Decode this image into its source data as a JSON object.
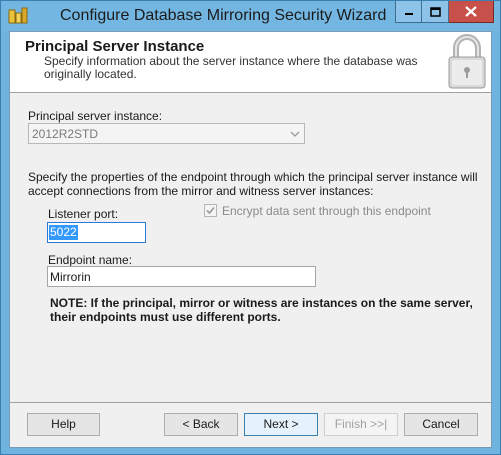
{
  "window": {
    "title": "Configure Database Mirroring Security Wizard"
  },
  "header": {
    "title": "Principal Server Instance",
    "description": "Specify information about the server instance where the database was originally located."
  },
  "form": {
    "principal_label": "Principal server instance:",
    "principal_value": "2012R2STD",
    "endpoint_description": "Specify the properties of the endpoint through which the principal server instance will accept connections from the mirror and witness server instances:",
    "listener_port_label": "Listener port:",
    "listener_port_value": "5022",
    "encrypt_label": "Encrypt data sent through this endpoint",
    "encrypt_checked": true,
    "endpoint_name_label": "Endpoint name:",
    "endpoint_name_value": "Mirrorin",
    "note": "NOTE: If the principal, mirror or witness are instances on the same server, their endpoints must use different ports."
  },
  "buttons": {
    "help": "Help",
    "back": "< Back",
    "next": "Next >",
    "finish": "Finish >>|",
    "cancel": "Cancel"
  },
  "colors": {
    "titlebar": "#73b6e2",
    "close_button": "#c7504a",
    "selection": "#3399ff"
  },
  "icons": {
    "app": "sql-server-icon",
    "header": "lock-icon",
    "combo": "chevron-down-icon",
    "check": "checkmark-icon"
  }
}
